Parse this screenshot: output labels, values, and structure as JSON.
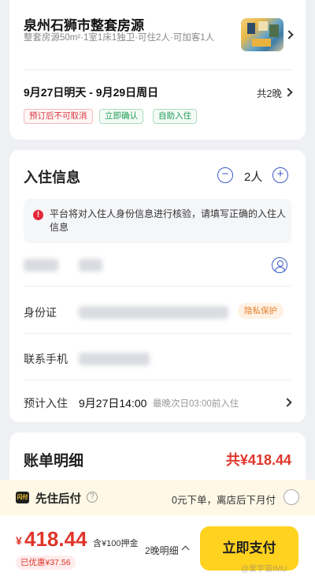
{
  "listing": {
    "title": "泉州石狮市整套房源",
    "desc": "整套房源50m²·1室1床1独卫·可住2人·可加客1人",
    "dates": "9月27日明天 - 9月29日周日",
    "nights": "共2晚",
    "tags": [
      "预订后不可取消",
      "立即确认",
      "自助入住"
    ]
  },
  "guest": {
    "section_title": "入住信息",
    "minus": "−",
    "plus": "+",
    "count": "2人",
    "notice_icon": "!",
    "notice": "平台将对入住人身份信息进行核验，请填写正确的入住人信息",
    "id_label": "身份证",
    "privacy": "隐私保护",
    "phone_label": "联系手机",
    "checkin_label": "预计入住",
    "checkin_time": "9月27日14:00",
    "checkin_hint": "最晚次日03:00前入住"
  },
  "bill": {
    "title": "账单明细",
    "total": "共¥418.44"
  },
  "pay_later": {
    "badge": "闪付",
    "title": "先住后付",
    "help": "?",
    "desc": "0元下单，离店后下月付"
  },
  "footer": {
    "currency": "¥",
    "price": "418.44",
    "deposit": "含¥100押金",
    "discount": "已优惠¥37.56",
    "detail": "2晚明细",
    "pay_button": "立即支付"
  },
  "watermark": "@爱宇宙IMU",
  "colors": {
    "accent_red": "#e0352b",
    "accent_blue": "#3a5cc8",
    "pay_yellow": "#ffd21f"
  }
}
